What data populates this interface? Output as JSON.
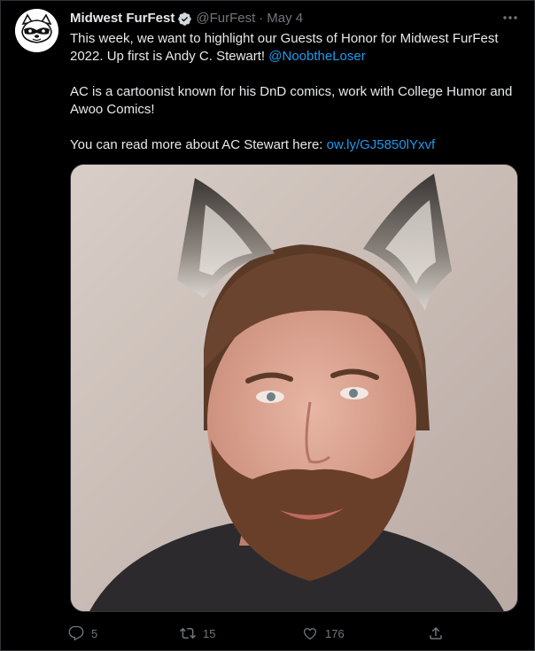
{
  "author": {
    "display_name": "Midwest FurFest",
    "handle": "@FurFest",
    "separator": "·",
    "date": "May 4",
    "avatar_icon": "raccoon-mascot-icon",
    "verified_icon": "verified-badge-icon"
  },
  "tweet": {
    "line1_text": "This week, we want to highlight our Guests of Honor for Midwest FurFest 2022. Up first is Andy C. Stewart! ",
    "line1_mention": "@NoobtheLoser",
    "para2": "AC is a cartoonist known for his DnD comics, work with College Humor and Awoo Comics!",
    "para3_text": "You can read more about AC Stewart here: ",
    "para3_link": "ow.ly/GJ5850lYxvf"
  },
  "actions": {
    "reply_count": "5",
    "retweet_count": "15",
    "like_count": "176"
  },
  "colors": {
    "background": "#000000",
    "text": "#e7e9ea",
    "secondary": "#71767b",
    "link": "#1d9bf0",
    "border": "#2f3336"
  }
}
